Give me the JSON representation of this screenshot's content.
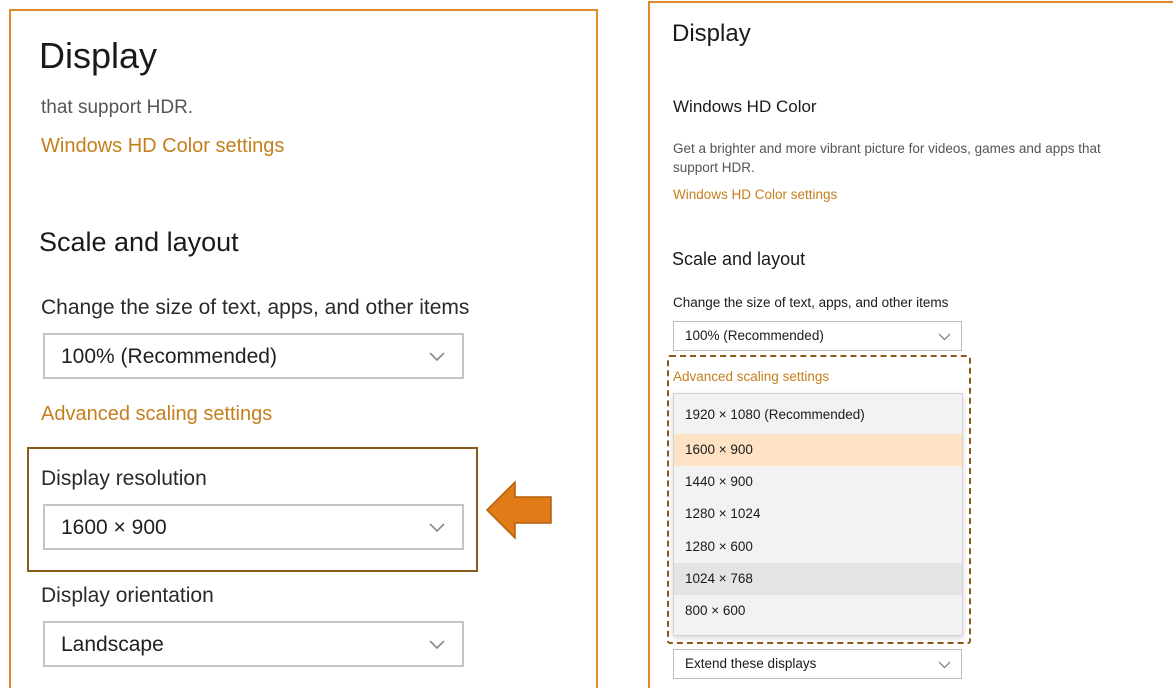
{
  "left": {
    "title": "Display",
    "hdr_text": "that support HDR.",
    "hdr_link": "Windows HD Color settings",
    "section": "Scale and layout",
    "size_label": "Change the size of text, apps, and other items",
    "size_value": "100% (Recommended)",
    "advanced_link": "Advanced scaling settings",
    "resolution_label": "Display resolution",
    "resolution_value": "1600 × 900",
    "orientation_label": "Display orientation",
    "orientation_value": "Landscape"
  },
  "right": {
    "title": "Display",
    "hdr_section": "Windows HD Color",
    "hdr_desc": "Get a brighter and more vibrant picture for videos, games and apps that support HDR.",
    "hdr_link": "Windows HD Color settings",
    "section": "Scale and layout",
    "size_label": "Change the size of text, apps, and other items",
    "size_value": "100% (Recommended)",
    "advanced_link": "Advanced scaling settings",
    "resolutions": [
      "1920 × 1080 (Recommended)",
      "1600 × 900",
      "1440 × 900",
      "1280 × 1024",
      "1280 × 600",
      "1024 × 768",
      "800 × 600"
    ],
    "selected_resolution": "1600 × 900",
    "multiple_displays_value": "Extend these displays"
  },
  "icons": {
    "dropdown": "chevron-down-icon",
    "pointer": "arrow-left-icon"
  },
  "colors": {
    "accent": "#c47f1c",
    "frame": "#e08a2a",
    "arrow": "#e07b17",
    "selected_bg": "#fde2c3"
  }
}
